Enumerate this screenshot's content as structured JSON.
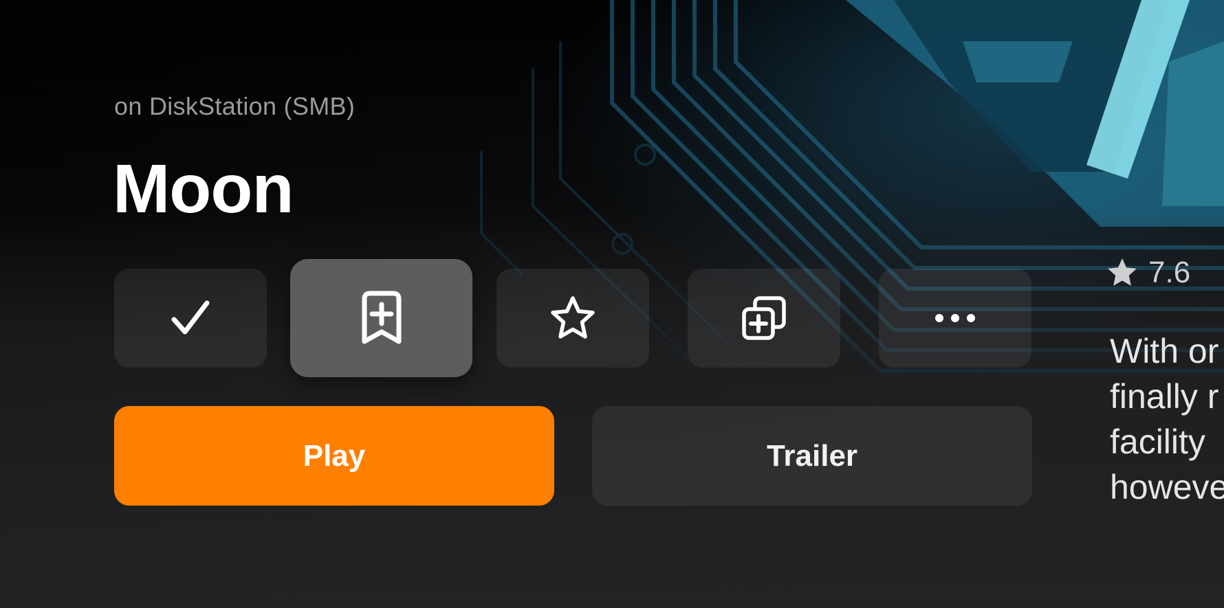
{
  "theme": {
    "accent": "#FF7F00",
    "focused_button_bg": "#5D5D5F"
  },
  "header": {
    "source": "on DiskStation (SMB)",
    "title": "Moon"
  },
  "actions": [
    {
      "icon": "checkmark-icon"
    },
    {
      "icon": "bookmark-plus-icon",
      "focused": true
    },
    {
      "icon": "star-outline-icon"
    },
    {
      "icon": "collection-add-icon"
    },
    {
      "icon": "ellipsis-icon"
    }
  ],
  "buttons": {
    "play_label": "Play",
    "trailer_label": "Trailer"
  },
  "rating": {
    "icon": "star-filled-icon",
    "value": "7.6"
  },
  "overview": {
    "lines": [
      "With or",
      "finally r",
      "facility",
      "howeve"
    ]
  }
}
